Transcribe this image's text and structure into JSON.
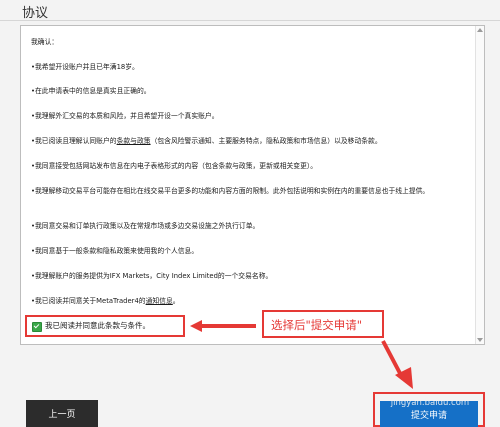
{
  "section": {
    "title": "协议"
  },
  "agreement": {
    "items": [
      "我确认：",
      "•我希望开设账户并且已年满18岁。",
      "•在此申请表中的信息是真实且正确的。",
      "•我理解外汇交易的本质和风险，并且希望开设一个真实账户。",
      [
        "•我已阅读且理解认同账户的",
        "条款与政策",
        "（包含风险警示通知、主要服务特点，隐私政策和市场信息）以及移动条款。"
      ],
      "•我同意接受包括网站发布信息在内电子表格形式的内容（包含条款与政策，更新或相关变更）。",
      "•我理解移动交易平台可能存在相比在线交易平台更多的功能和内容方面的限制。此外包括说明和实例在内的重要信息也于线上提供。",
      "•我同意交易和订单执行政策以及在常规市场或多边交易设施之外执行订单。",
      "•我同意基于一般条款和隐私政策来使用我的个人信息。",
      "•我理解账户的服务提供为IFX Markets，City Index Limited的一个交易名称。",
      [
        "•我已阅读并同意关于MetaTrader4的",
        "通知信息",
        "。"
      ]
    ],
    "checkbox_label": "我已阅读并同意此条款与条件。",
    "checkbox_checked": true
  },
  "annotations": {
    "instruction_text": "选择后\"提交申请\"",
    "accent_color": "#e53935"
  },
  "buttons": {
    "prev_label": "上一页",
    "submit_label": "提交申请"
  },
  "watermark": "jingyan.baidu.com"
}
